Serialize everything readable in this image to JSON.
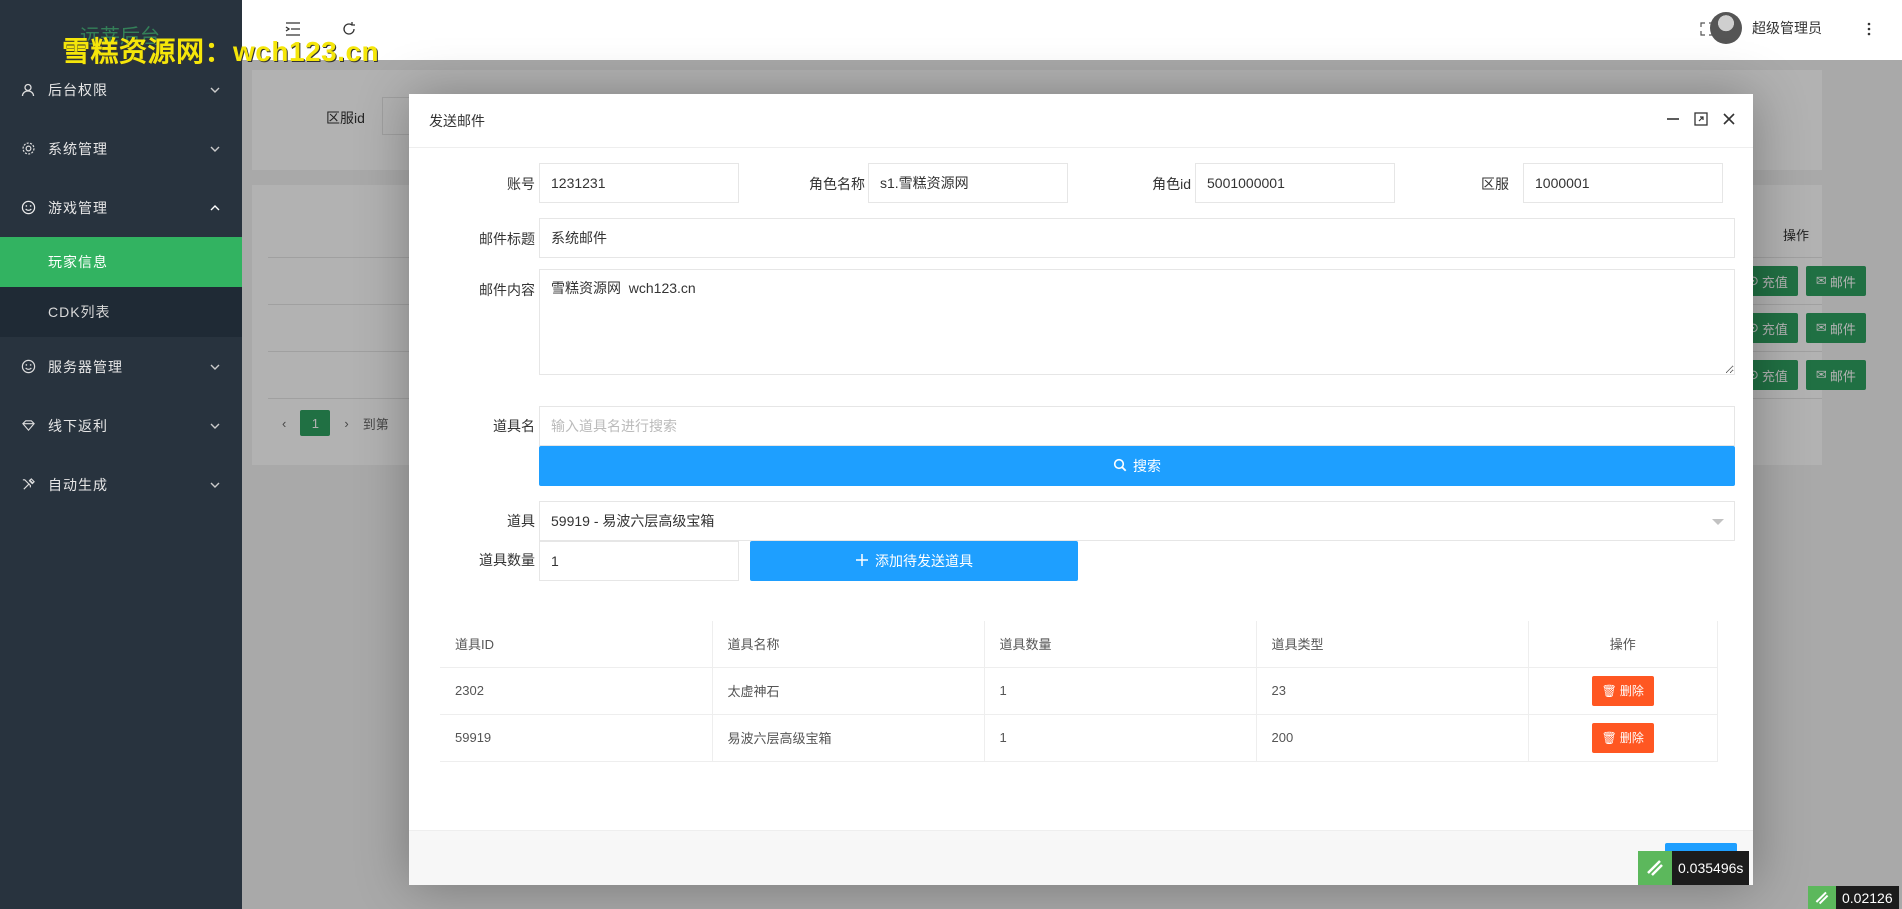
{
  "brand": {
    "title": "远莘后台"
  },
  "watermark": {
    "text": "雪糕资源网：wch123.cn"
  },
  "sidebar": {
    "items": [
      {
        "label": "后台权限",
        "icon": "user-icon"
      },
      {
        "label": "系统管理",
        "icon": "gear-icon"
      },
      {
        "label": "游戏管理",
        "icon": "smile-icon"
      },
      {
        "label": "服务器管理",
        "icon": "smile-icon"
      },
      {
        "label": "线下返利",
        "icon": "diamond-icon"
      },
      {
        "label": "自动生成",
        "icon": "tools-icon"
      }
    ],
    "sub_items": [
      {
        "label": "玩家信息",
        "active": true
      },
      {
        "label": "CDK列表",
        "active": false
      }
    ]
  },
  "header": {
    "username": "超级管理员"
  },
  "background_page": {
    "filter_label": "区服id",
    "column_ops": "操作",
    "recharge_label": "充值",
    "mail_label": "邮件",
    "page_number": "1",
    "goto_label": "到第"
  },
  "modal": {
    "title": "发送邮件",
    "fields": {
      "account_label": "账号",
      "account_value": "1231231",
      "role_name_label": "角色名称",
      "role_name_value": "s1.雪糕资源网",
      "role_id_label": "角色id",
      "role_id_value": "5001000001",
      "server_label": "区服",
      "server_value": "1000001",
      "mail_title_label": "邮件标题",
      "mail_title_value": "系统邮件",
      "mail_content_label": "邮件内容",
      "mail_content_value": "雪糕资源网  wch123.cn",
      "item_name_label": "道具名",
      "item_name_placeholder": "输入道具名进行搜索",
      "search_button": "搜索",
      "item_label": "道具",
      "item_selected": "59919 - 易波六层高级宝箱",
      "item_count_label": "道具数量",
      "item_count_value": "1",
      "add_button": "添加待发送道具"
    },
    "table": {
      "headers": [
        "道具ID",
        "道具名称",
        "道具数量",
        "道具类型",
        "操作"
      ],
      "rows": [
        {
          "id": "2302",
          "name": "太虚神石",
          "count": "1",
          "type": "23",
          "action": "删除"
        },
        {
          "id": "59919",
          "name": "易波六层高级宝箱",
          "count": "1",
          "type": "200",
          "action": "删除"
        }
      ]
    }
  },
  "timers": {
    "timer1": "0.035496s",
    "timer2": "0.02126"
  },
  "colors": {
    "sidebar_bg": "#28333e",
    "active_green": "#32b361",
    "primary_blue": "#1e9fff",
    "danger_orange": "#ff5722"
  }
}
